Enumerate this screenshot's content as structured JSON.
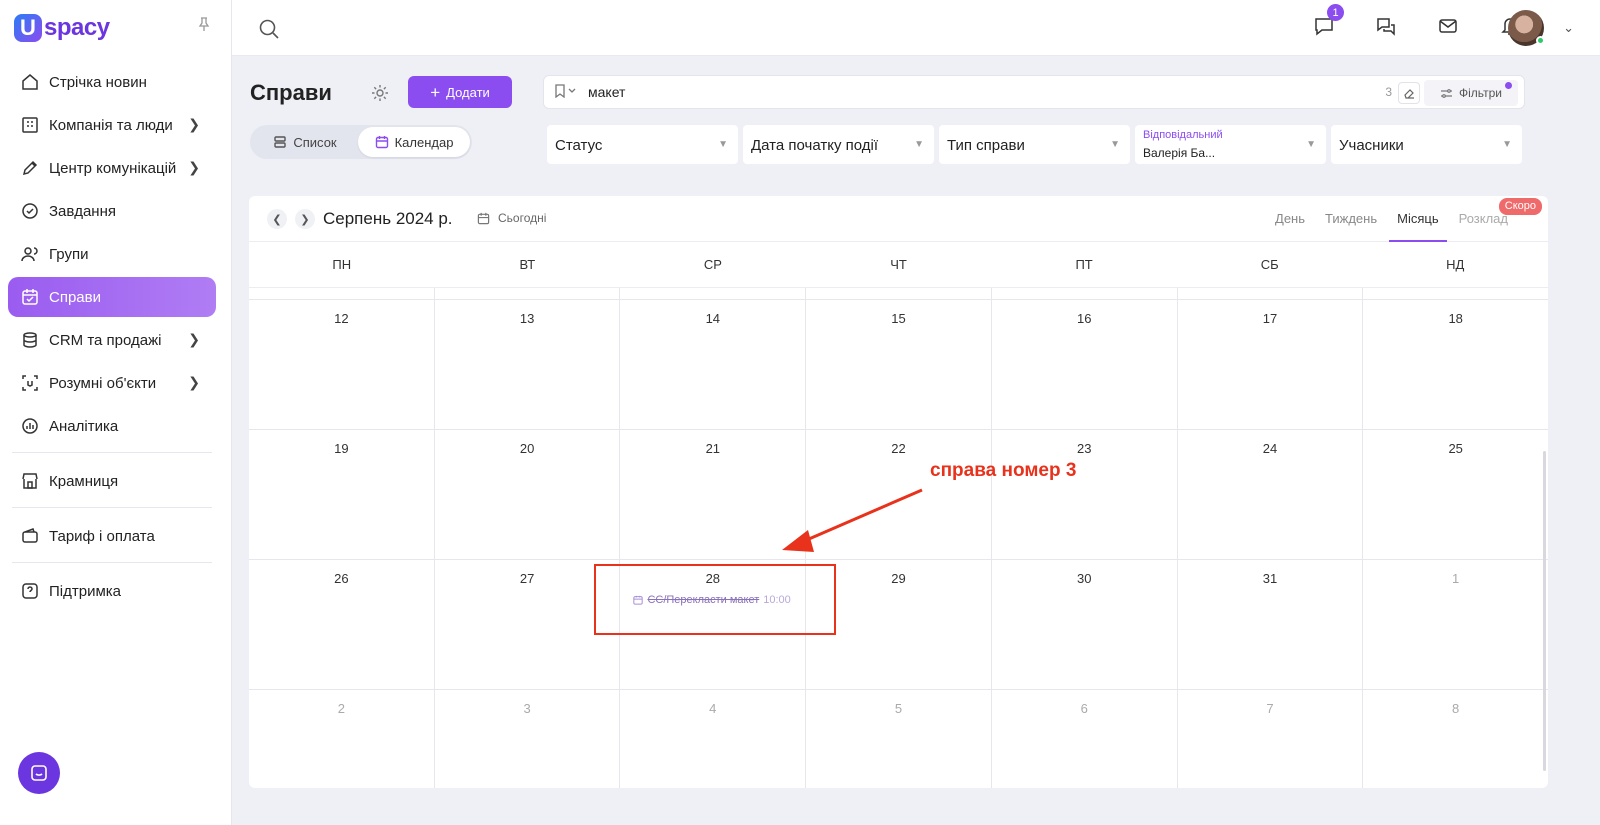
{
  "app": {
    "logo_letter": "U",
    "logo_text": "spacy"
  },
  "sidebar": {
    "items": [
      {
        "label": "Стрічка новин",
        "icon": "home-icon",
        "chevron": false,
        "active": false
      },
      {
        "label": "Компанія та люди",
        "icon": "building-icon",
        "chevron": true,
        "active": false
      },
      {
        "label": "Центр комунікацій",
        "icon": "edit-icon",
        "chevron": true,
        "active": false
      },
      {
        "label": "Завдання",
        "icon": "check-circle-icon",
        "chevron": false,
        "active": false
      },
      {
        "label": "Групи",
        "icon": "users-icon",
        "chevron": false,
        "active": false
      },
      {
        "label": "Справи",
        "icon": "calendar-check-icon",
        "chevron": false,
        "active": true
      },
      {
        "label": "CRM та продажі",
        "icon": "database-icon",
        "chevron": true,
        "active": false
      },
      {
        "label": "Розумні об'єкти",
        "icon": "smart-object-icon",
        "chevron": true,
        "active": false
      },
      {
        "label": "Аналітика",
        "icon": "chart-icon",
        "chevron": false,
        "active": false
      },
      {
        "label": "Крамниця",
        "icon": "store-icon",
        "chevron": false,
        "active": false
      },
      {
        "label": "Тариф і оплата",
        "icon": "wallet-icon",
        "chevron": false,
        "active": false
      },
      {
        "label": "Підтримка",
        "icon": "help-icon",
        "chevron": false,
        "active": false
      }
    ]
  },
  "topbar": {
    "chat_badge": "1"
  },
  "page": {
    "title": "Справи",
    "add_label": "Додати",
    "view_list": "Список",
    "view_calendar": "Календар"
  },
  "search": {
    "value": "макет",
    "count": "3",
    "filters_label": "Фільтри"
  },
  "filters": {
    "status": "Статус",
    "start_date": "Дата початку події",
    "case_type": "Тип справи",
    "responsible_label": "Відповідальний",
    "responsible_value": "Валерія Ба...",
    "participants": "Учасники"
  },
  "calendar": {
    "month_title": "Серпень 2024 р.",
    "today": "Сьогодні",
    "views": [
      "День",
      "Тиждень",
      "Місяць",
      "Розклад"
    ],
    "soon": "Скоро",
    "weekdays": [
      "ПН",
      "ВТ",
      "СР",
      "ЧТ",
      "ПТ",
      "СБ",
      "НД"
    ],
    "weeks": [
      [
        {
          "d": "12"
        },
        {
          "d": "13"
        },
        {
          "d": "14"
        },
        {
          "d": "15"
        },
        {
          "d": "16"
        },
        {
          "d": "17"
        },
        {
          "d": "18"
        }
      ],
      [
        {
          "d": "19"
        },
        {
          "d": "20"
        },
        {
          "d": "21"
        },
        {
          "d": "22"
        },
        {
          "d": "23"
        },
        {
          "d": "24"
        },
        {
          "d": "25"
        }
      ],
      [
        {
          "d": "26"
        },
        {
          "d": "27"
        },
        {
          "d": "28"
        },
        {
          "d": "29"
        },
        {
          "d": "30"
        },
        {
          "d": "31"
        },
        {
          "d": "1",
          "other": true
        }
      ],
      [
        {
          "d": "2",
          "other": true
        },
        {
          "d": "3",
          "other": true
        },
        {
          "d": "4",
          "other": true
        },
        {
          "d": "5",
          "other": true
        },
        {
          "d": "6",
          "other": true
        },
        {
          "d": "7",
          "other": true
        },
        {
          "d": "8",
          "other": true
        }
      ]
    ],
    "event": {
      "title": "СС/Перекласти макет",
      "time": "10:00"
    }
  },
  "annotation": {
    "text": "справа номер 3",
    "color": "#e8321c"
  },
  "colors": {
    "accent": "#8b4cf0"
  }
}
